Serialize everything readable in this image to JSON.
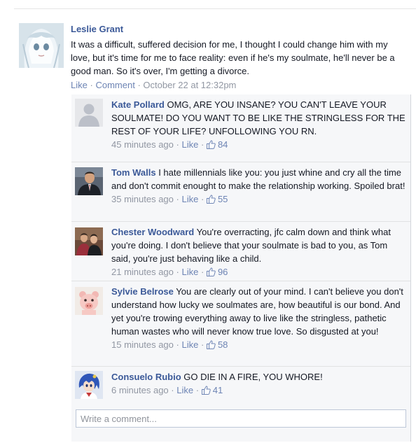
{
  "post": {
    "author": "Leslie Grant",
    "text": "It was a difficult, suffered decision for me, I thought I could change him with my love, but it's time for me to face reality: even if he's my soulmate, he'll never be a good man. So it's over, I'm getting a divorce.",
    "like_label": "Like",
    "comment_label": "Comment",
    "timestamp": "October 22 at 12:32pm",
    "separator": "·"
  },
  "comments": [
    {
      "author": "Kate Pollard",
      "text": "OMG, ARE YOU INSANE? YOU CAN'T LEAVE YOUR SOULMATE! DO YOU WANT TO BE LIKE THE STRINGLESS FOR THE REST OF YOUR LIFE? UNFOLLOWING YOU RN.",
      "time": "45 minutes ago",
      "like_label": "Like",
      "likes": "84",
      "avatar": "default-silhouette"
    },
    {
      "author": "Tom Walls",
      "text": "I hate millennials like you: you just whine and cry all the time and don't commit enought to make the relationship working. Spoiled brat!",
      "time": "35 minutes ago",
      "like_label": "Like",
      "likes": "55",
      "avatar": "man-in-suit-photo"
    },
    {
      "author": "Chester Woodward",
      "text": "You're overracting, jfc calm down and think what you're doing. I don't believe that your soulmate is bad to you, as Tom said, you're just behaving like a child.",
      "time": "21 minutes ago",
      "like_label": "Like",
      "likes": "96",
      "avatar": "two-people-photo"
    },
    {
      "author": "Sylvie Belrose",
      "text": "You are clearly out of your mind. I can't believe you don't understand how lucky we soulmates are, how beautiful is our bond. And yet you're trowing everything away to live like the stringless, pathetic human wastes who will never know true love. So disgusted at you!",
      "time": "15 minutes ago",
      "like_label": "Like",
      "likes": "58",
      "avatar": "pink-pig-face"
    },
    {
      "author": "Consuelo Rubio",
      "text": "GO DIE IN A FIRE, YOU WHORE!",
      "time": "6 minutes ago",
      "like_label": "Like",
      "likes": "41",
      "avatar": "anime-character-blue-hair"
    }
  ],
  "composer": {
    "placeholder": "Write a comment..."
  },
  "colors": {
    "link": "#3b5998",
    "muted_link": "#6d84b4",
    "meta": "#9197a3",
    "comment_bg": "#f6f7f9"
  }
}
